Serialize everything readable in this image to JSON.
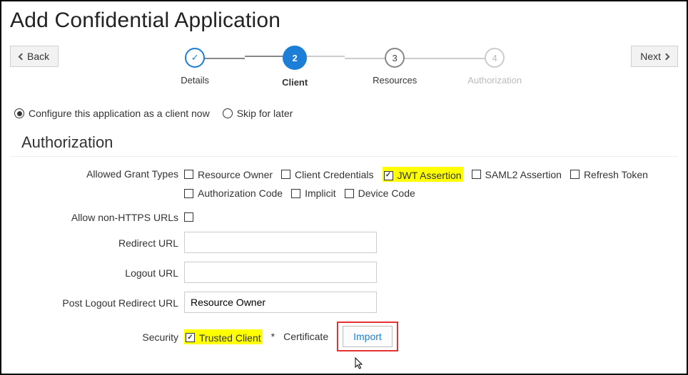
{
  "page": {
    "title": "Add Confidential Application"
  },
  "nav": {
    "back": "Back",
    "next": "Next"
  },
  "stepper": {
    "s1": {
      "label": "Details",
      "mark": "✓"
    },
    "s2": {
      "label": "Client",
      "num": "2"
    },
    "s3": {
      "label": "Resources",
      "num": "3"
    },
    "s4": {
      "label": "Authorization",
      "num": "4"
    }
  },
  "config": {
    "opt_now": "Configure this application as a client now",
    "opt_skip": "Skip for later"
  },
  "section": {
    "authz": "Authorization"
  },
  "labels": {
    "grant_types": "Allowed Grant Types",
    "allow_http": "Allow non-HTTPS URLs",
    "redirect_url": "Redirect URL",
    "logout_url": "Logout URL",
    "post_logout": "Post Logout Redirect URL",
    "security": "Security"
  },
  "grant": {
    "resource_owner": "Resource Owner",
    "client_creds": "Client Credentials",
    "jwt": "JWT Assertion",
    "saml2": "SAML2 Assertion",
    "refresh": "Refresh Token",
    "authz_code": "Authorization Code",
    "implicit": "Implicit",
    "device": "Device Code"
  },
  "fields": {
    "redirect_url": "",
    "logout_url": "",
    "post_logout": "Resource Owner"
  },
  "security": {
    "trusted_client": "Trusted Client",
    "cert_label": "Certificate",
    "import": "Import",
    "req": "*"
  }
}
